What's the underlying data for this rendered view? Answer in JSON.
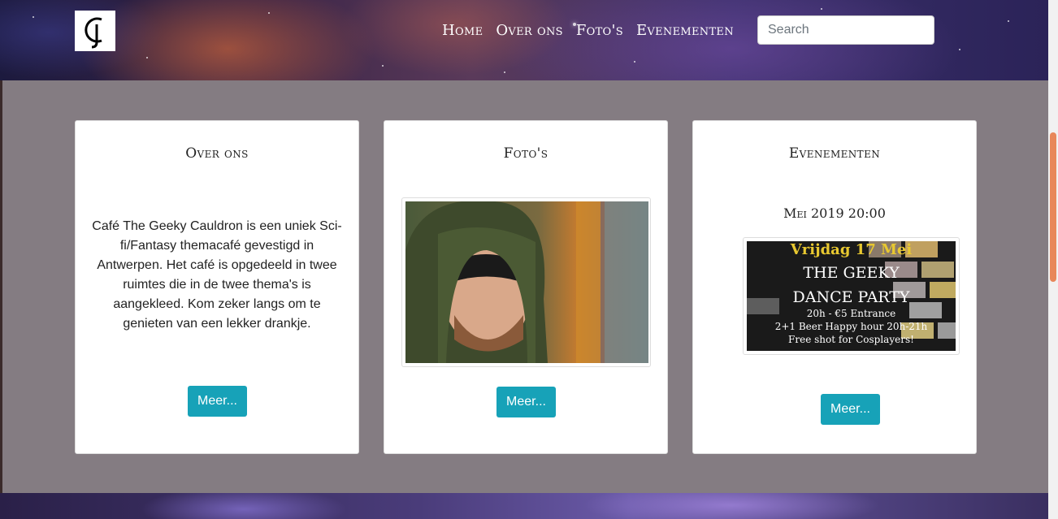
{
  "header": {
    "nav": [
      "Home",
      "Over ons",
      "Foto's",
      "Evenementen"
    ],
    "search_placeholder": "Search"
  },
  "cards": [
    {
      "title": "Over ons",
      "text": "Café The Geeky Cauldron is een uniek Sci-fi/Fantasy themacafé gevestigd in Antwerpen. Het café is opgedeeld in twee ruimtes die in de twee thema's is aangekleed. Kom zeker langs om te genieten van een lekker drankje.",
      "button": "Meer..."
    },
    {
      "title": "Foto's",
      "button": "Meer..."
    },
    {
      "title": "Evenementen",
      "date": "Mei 2019 20:00",
      "poster": {
        "line1": "Vrijdag 17 Mei",
        "line2": "THE GEEKY",
        "line3": "DANCE PARTY",
        "line4": "20h - €5 Entrance",
        "line5": "2+1 Beer Happy hour 20h-21h",
        "line6": "Free shot for Cosplayers!"
      },
      "button": "Meer..."
    }
  ],
  "colors": {
    "accent": "#17a2b8",
    "main_bg": "#847c82",
    "scroll_thumb": "#e8875a"
  }
}
